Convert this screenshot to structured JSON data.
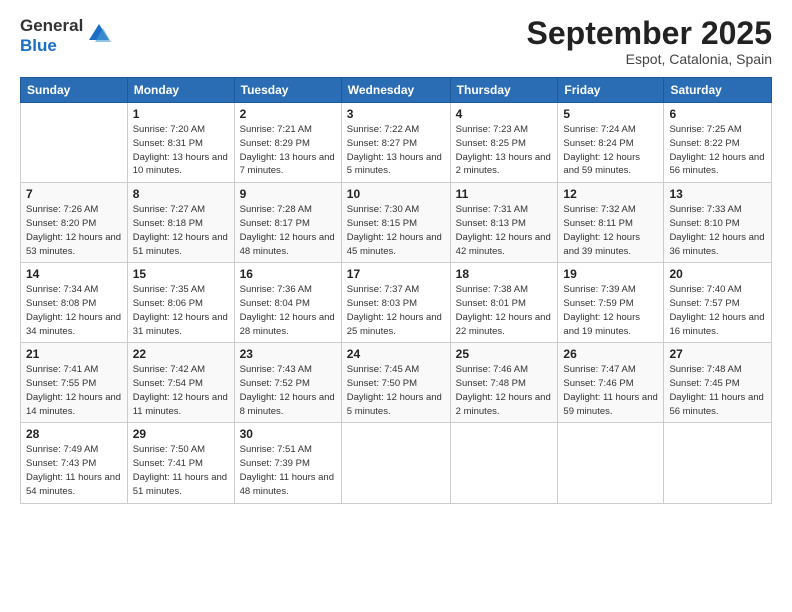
{
  "header": {
    "logo_general": "General",
    "logo_blue": "Blue",
    "month_title": "September 2025",
    "subtitle": "Espot, Catalonia, Spain"
  },
  "weekdays": [
    "Sunday",
    "Monday",
    "Tuesday",
    "Wednesday",
    "Thursday",
    "Friday",
    "Saturday"
  ],
  "weeks": [
    [
      {
        "day": "",
        "sunrise": "",
        "sunset": "",
        "daylight": ""
      },
      {
        "day": "1",
        "sunrise": "Sunrise: 7:20 AM",
        "sunset": "Sunset: 8:31 PM",
        "daylight": "Daylight: 13 hours and 10 minutes."
      },
      {
        "day": "2",
        "sunrise": "Sunrise: 7:21 AM",
        "sunset": "Sunset: 8:29 PM",
        "daylight": "Daylight: 13 hours and 7 minutes."
      },
      {
        "day": "3",
        "sunrise": "Sunrise: 7:22 AM",
        "sunset": "Sunset: 8:27 PM",
        "daylight": "Daylight: 13 hours and 5 minutes."
      },
      {
        "day": "4",
        "sunrise": "Sunrise: 7:23 AM",
        "sunset": "Sunset: 8:25 PM",
        "daylight": "Daylight: 13 hours and 2 minutes."
      },
      {
        "day": "5",
        "sunrise": "Sunrise: 7:24 AM",
        "sunset": "Sunset: 8:24 PM",
        "daylight": "Daylight: 12 hours and 59 minutes."
      },
      {
        "day": "6",
        "sunrise": "Sunrise: 7:25 AM",
        "sunset": "Sunset: 8:22 PM",
        "daylight": "Daylight: 12 hours and 56 minutes."
      }
    ],
    [
      {
        "day": "7",
        "sunrise": "Sunrise: 7:26 AM",
        "sunset": "Sunset: 8:20 PM",
        "daylight": "Daylight: 12 hours and 53 minutes."
      },
      {
        "day": "8",
        "sunrise": "Sunrise: 7:27 AM",
        "sunset": "Sunset: 8:18 PM",
        "daylight": "Daylight: 12 hours and 51 minutes."
      },
      {
        "day": "9",
        "sunrise": "Sunrise: 7:28 AM",
        "sunset": "Sunset: 8:17 PM",
        "daylight": "Daylight: 12 hours and 48 minutes."
      },
      {
        "day": "10",
        "sunrise": "Sunrise: 7:30 AM",
        "sunset": "Sunset: 8:15 PM",
        "daylight": "Daylight: 12 hours and 45 minutes."
      },
      {
        "day": "11",
        "sunrise": "Sunrise: 7:31 AM",
        "sunset": "Sunset: 8:13 PM",
        "daylight": "Daylight: 12 hours and 42 minutes."
      },
      {
        "day": "12",
        "sunrise": "Sunrise: 7:32 AM",
        "sunset": "Sunset: 8:11 PM",
        "daylight": "Daylight: 12 hours and 39 minutes."
      },
      {
        "day": "13",
        "sunrise": "Sunrise: 7:33 AM",
        "sunset": "Sunset: 8:10 PM",
        "daylight": "Daylight: 12 hours and 36 minutes."
      }
    ],
    [
      {
        "day": "14",
        "sunrise": "Sunrise: 7:34 AM",
        "sunset": "Sunset: 8:08 PM",
        "daylight": "Daylight: 12 hours and 34 minutes."
      },
      {
        "day": "15",
        "sunrise": "Sunrise: 7:35 AM",
        "sunset": "Sunset: 8:06 PM",
        "daylight": "Daylight: 12 hours and 31 minutes."
      },
      {
        "day": "16",
        "sunrise": "Sunrise: 7:36 AM",
        "sunset": "Sunset: 8:04 PM",
        "daylight": "Daylight: 12 hours and 28 minutes."
      },
      {
        "day": "17",
        "sunrise": "Sunrise: 7:37 AM",
        "sunset": "Sunset: 8:03 PM",
        "daylight": "Daylight: 12 hours and 25 minutes."
      },
      {
        "day": "18",
        "sunrise": "Sunrise: 7:38 AM",
        "sunset": "Sunset: 8:01 PM",
        "daylight": "Daylight: 12 hours and 22 minutes."
      },
      {
        "day": "19",
        "sunrise": "Sunrise: 7:39 AM",
        "sunset": "Sunset: 7:59 PM",
        "daylight": "Daylight: 12 hours and 19 minutes."
      },
      {
        "day": "20",
        "sunrise": "Sunrise: 7:40 AM",
        "sunset": "Sunset: 7:57 PM",
        "daylight": "Daylight: 12 hours and 16 minutes."
      }
    ],
    [
      {
        "day": "21",
        "sunrise": "Sunrise: 7:41 AM",
        "sunset": "Sunset: 7:55 PM",
        "daylight": "Daylight: 12 hours and 14 minutes."
      },
      {
        "day": "22",
        "sunrise": "Sunrise: 7:42 AM",
        "sunset": "Sunset: 7:54 PM",
        "daylight": "Daylight: 12 hours and 11 minutes."
      },
      {
        "day": "23",
        "sunrise": "Sunrise: 7:43 AM",
        "sunset": "Sunset: 7:52 PM",
        "daylight": "Daylight: 12 hours and 8 minutes."
      },
      {
        "day": "24",
        "sunrise": "Sunrise: 7:45 AM",
        "sunset": "Sunset: 7:50 PM",
        "daylight": "Daylight: 12 hours and 5 minutes."
      },
      {
        "day": "25",
        "sunrise": "Sunrise: 7:46 AM",
        "sunset": "Sunset: 7:48 PM",
        "daylight": "Daylight: 12 hours and 2 minutes."
      },
      {
        "day": "26",
        "sunrise": "Sunrise: 7:47 AM",
        "sunset": "Sunset: 7:46 PM",
        "daylight": "Daylight: 11 hours and 59 minutes."
      },
      {
        "day": "27",
        "sunrise": "Sunrise: 7:48 AM",
        "sunset": "Sunset: 7:45 PM",
        "daylight": "Daylight: 11 hours and 56 minutes."
      }
    ],
    [
      {
        "day": "28",
        "sunrise": "Sunrise: 7:49 AM",
        "sunset": "Sunset: 7:43 PM",
        "daylight": "Daylight: 11 hours and 54 minutes."
      },
      {
        "day": "29",
        "sunrise": "Sunrise: 7:50 AM",
        "sunset": "Sunset: 7:41 PM",
        "daylight": "Daylight: 11 hours and 51 minutes."
      },
      {
        "day": "30",
        "sunrise": "Sunrise: 7:51 AM",
        "sunset": "Sunset: 7:39 PM",
        "daylight": "Daylight: 11 hours and 48 minutes."
      },
      {
        "day": "",
        "sunrise": "",
        "sunset": "",
        "daylight": ""
      },
      {
        "day": "",
        "sunrise": "",
        "sunset": "",
        "daylight": ""
      },
      {
        "day": "",
        "sunrise": "",
        "sunset": "",
        "daylight": ""
      },
      {
        "day": "",
        "sunrise": "",
        "sunset": "",
        "daylight": ""
      }
    ]
  ]
}
